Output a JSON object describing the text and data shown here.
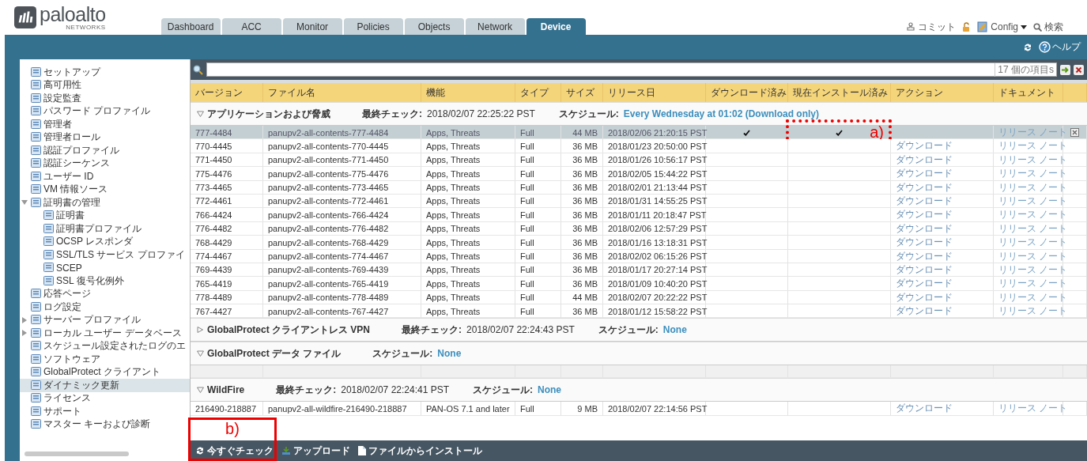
{
  "logo": {
    "name": "paloalto",
    "sub": "NETWORKS"
  },
  "tabs": [
    {
      "label": "Dashboard",
      "selected": false
    },
    {
      "label": "ACC",
      "selected": false
    },
    {
      "label": "Monitor",
      "selected": false
    },
    {
      "label": "Policies",
      "selected": false
    },
    {
      "label": "Objects",
      "selected": false
    },
    {
      "label": "Network",
      "selected": false
    },
    {
      "label": "Device",
      "selected": true
    }
  ],
  "top_actions": {
    "commit": "コミット",
    "config": "Config",
    "search": "検索"
  },
  "toolbar": {
    "help": "ヘルプ"
  },
  "sidebar": {
    "items": [
      {
        "label": "セットアップ",
        "selected": false
      },
      {
        "label": "高可用性",
        "selected": false
      },
      {
        "label": "設定監査",
        "selected": false
      },
      {
        "label": "パスワード プロファイル",
        "selected": false
      },
      {
        "label": "管理者",
        "selected": false
      },
      {
        "label": "管理者ロール",
        "selected": false
      },
      {
        "label": "認証プロファイル",
        "selected": false
      },
      {
        "label": "認証シーケンス",
        "selected": false
      },
      {
        "label": "ユーザー ID",
        "selected": false
      },
      {
        "label": "VM 情報ソース",
        "selected": false
      },
      {
        "label": "証明書の管理",
        "selected": false,
        "expanded": true,
        "children": [
          {
            "label": "証明書",
            "selected": false
          },
          {
            "label": "証明書プロファイル",
            "selected": false
          },
          {
            "label": "OCSP レスポンダ",
            "selected": false
          },
          {
            "label": "SSL/TLS サービス プロファイ",
            "selected": false
          },
          {
            "label": "SCEP",
            "selected": false
          },
          {
            "label": "SSL 復号化例外",
            "selected": false
          }
        ]
      },
      {
        "label": "応答ページ",
        "selected": false
      },
      {
        "label": "ログ設定",
        "selected": false
      },
      {
        "label": "サーバー プロファイル",
        "selected": false,
        "expanded": false
      },
      {
        "label": "ローカル ユーザー データベース",
        "selected": false,
        "expanded": false
      },
      {
        "label": "スケジュール設定されたログのエ",
        "selected": false
      },
      {
        "label": "ソフトウェア",
        "selected": false
      },
      {
        "label": "GlobalProtect クライアント",
        "selected": false
      },
      {
        "label": "ダイナミック更新",
        "selected": true
      },
      {
        "label": "ライセンス",
        "selected": false
      },
      {
        "label": "サポート",
        "selected": false
      },
      {
        "label": "マスター キーおよび診断",
        "selected": false
      }
    ]
  },
  "filter": {
    "count": "17 個の項目s"
  },
  "table": {
    "columns": [
      "バージョン",
      "ファイル名",
      "機能",
      "タイプ",
      "サイズ",
      "リリース日",
      "ダウンロード済み",
      "現在インストール済み",
      "アクション",
      "ドキュメント"
    ],
    "groups": [
      {
        "title": "アプリケーションおよび脅威",
        "expanded": true,
        "check_label": "最終チェック:",
        "check_value": "2018/02/07 22:25:22 PST",
        "schedule_label": "スケジュール:",
        "schedule_value": "Every Wednesday at 01:02 (Download only)",
        "rows": [
          {
            "version": "777-4484",
            "file": "panupv2-all-contents-777-4484",
            "features": "Apps, Threats",
            "type": "Full",
            "size": "44 MB",
            "released": "2018/02/06 21:20:15 PST",
            "downloaded": true,
            "installed": true,
            "document": "リリース ノート",
            "selected": true,
            "marker": "a)"
          },
          {
            "version": "770-4445",
            "file": "panupv2-all-contents-770-4445",
            "features": "Apps, Threats",
            "type": "Full",
            "size": "36 MB",
            "released": "2018/01/23 20:50:00 PST",
            "downloaded": false,
            "installed": false,
            "action": "ダウンロード",
            "document": "リリース ノート",
            "selected": false
          },
          {
            "version": "771-4450",
            "file": "panupv2-all-contents-771-4450",
            "features": "Apps, Threats",
            "type": "Full",
            "size": "36 MB",
            "released": "2018/01/26 10:56:17 PST",
            "downloaded": false,
            "installed": false,
            "action": "ダウンロード",
            "document": "リリース ノート",
            "selected": false
          },
          {
            "version": "775-4476",
            "file": "panupv2-all-contents-775-4476",
            "features": "Apps, Threats",
            "type": "Full",
            "size": "36 MB",
            "released": "2018/02/05 15:44:22 PST",
            "downloaded": false,
            "installed": false,
            "action": "ダウンロード",
            "document": "リリース ノート",
            "selected": false
          },
          {
            "version": "773-4465",
            "file": "panupv2-all-contents-773-4465",
            "features": "Apps, Threats",
            "type": "Full",
            "size": "36 MB",
            "released": "2018/02/01 21:13:44 PST",
            "downloaded": false,
            "installed": false,
            "action": "ダウンロード",
            "document": "リリース ノート",
            "selected": false
          },
          {
            "version": "772-4461",
            "file": "panupv2-all-contents-772-4461",
            "features": "Apps, Threats",
            "type": "Full",
            "size": "36 MB",
            "released": "2018/01/31 14:55:25 PST",
            "downloaded": false,
            "installed": false,
            "action": "ダウンロード",
            "document": "リリース ノート",
            "selected": false
          },
          {
            "version": "766-4424",
            "file": "panupv2-all-contents-766-4424",
            "features": "Apps, Threats",
            "type": "Full",
            "size": "36 MB",
            "released": "2018/01/11 20:18:47 PST",
            "downloaded": false,
            "installed": false,
            "action": "ダウンロード",
            "document": "リリース ノート",
            "selected": false
          },
          {
            "version": "776-4482",
            "file": "panupv2-all-contents-776-4482",
            "features": "Apps, Threats",
            "type": "Full",
            "size": "36 MB",
            "released": "2018/02/06 12:57:29 PST",
            "downloaded": false,
            "installed": false,
            "action": "ダウンロード",
            "document": "リリース ノート",
            "selected": false
          },
          {
            "version": "768-4429",
            "file": "panupv2-all-contents-768-4429",
            "features": "Apps, Threats",
            "type": "Full",
            "size": "36 MB",
            "released": "2018/01/16 13:18:31 PST",
            "downloaded": false,
            "installed": false,
            "action": "ダウンロード",
            "document": "リリース ノート",
            "selected": false
          },
          {
            "version": "774-4467",
            "file": "panupv2-all-contents-774-4467",
            "features": "Apps, Threats",
            "type": "Full",
            "size": "36 MB",
            "released": "2018/02/02 06:15:26 PST",
            "downloaded": false,
            "installed": false,
            "action": "ダウンロード",
            "document": "リリース ノート",
            "selected": false
          },
          {
            "version": "769-4439",
            "file": "panupv2-all-contents-769-4439",
            "features": "Apps, Threats",
            "type": "Full",
            "size": "36 MB",
            "released": "2018/01/17 20:27:14 PST",
            "downloaded": false,
            "installed": false,
            "action": "ダウンロード",
            "document": "リリース ノート",
            "selected": false
          },
          {
            "version": "765-4419",
            "file": "panupv2-all-contents-765-4419",
            "features": "Apps, Threats",
            "type": "Full",
            "size": "36 MB",
            "released": "2018/01/09 10:40:20 PST",
            "downloaded": false,
            "installed": false,
            "action": "ダウンロード",
            "document": "リリース ノート",
            "selected": false
          },
          {
            "version": "778-4489",
            "file": "panupv2-all-contents-778-4489",
            "features": "Apps, Threats",
            "type": "Full",
            "size": "44 MB",
            "released": "2018/02/07 20:22:22 PST",
            "downloaded": false,
            "installed": false,
            "action": "ダウンロード",
            "document": "リリース ノート",
            "selected": false
          },
          {
            "version": "767-4427",
            "file": "panupv2-all-contents-767-4427",
            "features": "Apps, Threats",
            "type": "Full",
            "size": "36 MB",
            "released": "2018/01/12 15:58:22 PST",
            "downloaded": false,
            "installed": false,
            "action": "ダウンロード",
            "document": "リリース ノート",
            "selected": false
          }
        ]
      },
      {
        "title": "GlobalProtect クライアントレス VPN",
        "expanded": false,
        "check_label": "最終チェック:",
        "check_value": "2018/02/07 22:24:43 PST",
        "schedule_label": "スケジュール:",
        "schedule_value": "None"
      },
      {
        "title": "GlobalProtect データ ファイル",
        "expanded": true,
        "schedule_label": "スケジュール:",
        "schedule_value": "None"
      },
      {
        "title": "WildFire",
        "expanded": true,
        "check_label": "最終チェック:",
        "check_value": "2018/02/07 22:24:41 PST",
        "schedule_label": "スケジュール:",
        "schedule_value": "None",
        "rows": [
          {
            "version": "216490-218887",
            "file": "panupv2-all-wildfire-216490-218887",
            "features": "PAN-OS 7.1 and later",
            "type": "Full",
            "size": "9 MB",
            "released": "2018/02/07 22:14:56 PST",
            "downloaded": false,
            "installed": false,
            "action": "ダウンロード",
            "document": "リリース ノート",
            "selected": false
          }
        ]
      }
    ]
  },
  "bottom_bar": {
    "buttons": [
      {
        "label": "今すぐチェック",
        "kind": "refresh",
        "marker": "b)"
      },
      {
        "label": "アップロード",
        "kind": "upload"
      },
      {
        "label": "ファイルからインストール",
        "kind": "file"
      }
    ]
  }
}
